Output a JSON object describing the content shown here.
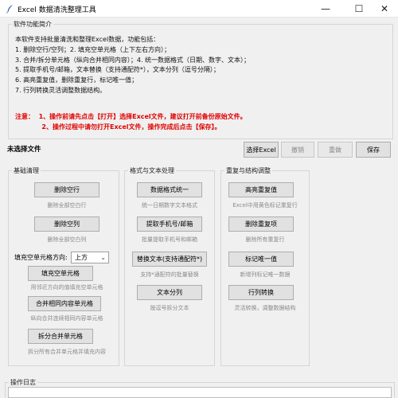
{
  "window": {
    "title": "Excel 数据清洗整理工具",
    "min": "—",
    "max": "☐",
    "close": "✕"
  },
  "intro": {
    "legend": "软件功能简介",
    "lines": [
      "本软件支持批量清洗和整理Excel数据，功能包括：",
      "1. 删除空行/空列；2. 填充空单元格（上下左右方向）；",
      "3. 合并/拆分单元格（纵向合并相同内容）；4. 统一数据格式（日期、数字、文本）；",
      "5. 提取手机号/邮箱，文本替换（支持通配符*），文本分列（逗号分隔）；",
      "6. 高亮重复值，删除重复行，标记唯一值；",
      "7. 行列转换灵活调整数据结构。"
    ],
    "notes": [
      "注意：  1、操作前请先点击【打开】选择Excel文件，建议打开前备份原始文件。",
      "            2、操作过程中请勿打开Excel文件，操作完成后点击【保存】。"
    ]
  },
  "toolbar": {
    "file_status": "未选择文件",
    "select_excel": "选择Excel",
    "undo": "撤销",
    "redo": "重做",
    "save": "保存"
  },
  "basic": {
    "legend": "基础清理",
    "delete_rows": "删除空行",
    "delete_rows_desc": "删除全部空白行",
    "delete_cols": "删除空列",
    "delete_cols_desc": "删除全部空白列",
    "fill_direction_label": "填充空单元格方向:",
    "fill_direction_value": "上方",
    "fill_empty": "填充空单元格",
    "fill_empty_desc": "用邻近方向的值填充空单元格",
    "merge_same": "合并相同内容单元格",
    "merge_same_desc": "纵向合并连续相同内容单元格",
    "split_merged": "拆分合并单元格",
    "split_merged_desc": "拆分所有合并单元格并填充内容"
  },
  "format": {
    "legend": "格式与文本处理",
    "unify": "数据格式统一",
    "unify_desc": "统一日期数字文本格式",
    "extract": "提取手机号/邮箱",
    "extract_desc": "批量提取手机号和邮箱",
    "replace": "替换文本(支持通配符*)",
    "replace_desc": "支持*通配符的批量替换",
    "split_text": "文本分列",
    "split_text_desc": "按逗号拆分文本"
  },
  "dup": {
    "legend": "重复与结构调整",
    "highlight": "高亮重复值",
    "highlight_desc": "Excel中用黄色标记重复行",
    "delete_dup": "删除重复项",
    "delete_dup_desc": "删除所有重复行",
    "mark_unique": "标记唯一值",
    "mark_unique_desc": "新增列标记唯一数据",
    "transpose": "行列转换",
    "transpose_desc": "灵活转换，调整数据结构"
  },
  "log": {
    "legend": "操作日志"
  },
  "colors": {
    "accent_red": "#e00000",
    "border": "#adadad",
    "button_bg": "#e1e1e1"
  }
}
